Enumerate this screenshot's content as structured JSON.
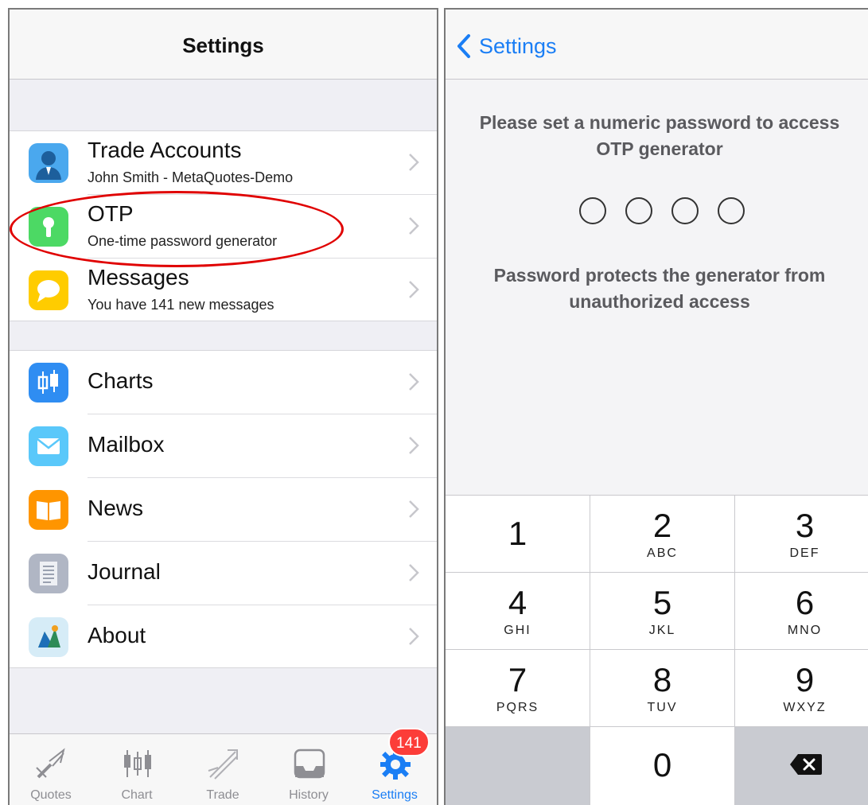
{
  "left": {
    "title": "Settings",
    "group1": [
      {
        "title": "Trade Accounts",
        "subtitle": "John  Smith - MetaQuotes-Demo",
        "icon": "person-icon",
        "color": "#4aa8ee"
      },
      {
        "title": "OTP",
        "subtitle": "One-time password generator",
        "icon": "keyhole-icon",
        "color": "#4cd964"
      },
      {
        "title": "Messages",
        "subtitle": "You have 141 new messages",
        "icon": "speech-bubble-icon",
        "color": "#ffcc00"
      }
    ],
    "group2": [
      {
        "title": "Charts",
        "icon": "candlestick-icon",
        "color": "#2f8df2"
      },
      {
        "title": "Mailbox",
        "icon": "envelope-icon",
        "color": "#5ac8fa"
      },
      {
        "title": "News",
        "icon": "book-icon",
        "color": "#ff9500"
      },
      {
        "title": "Journal",
        "icon": "document-icon",
        "color": "#b0b6c4"
      },
      {
        "title": "About",
        "icon": "metatrader-logo-icon",
        "color": "#d6ecf7"
      }
    ],
    "tabs": [
      {
        "label": "Quotes"
      },
      {
        "label": "Chart"
      },
      {
        "label": "Trade"
      },
      {
        "label": "History"
      },
      {
        "label": "Settings"
      }
    ],
    "badge": "141",
    "accent": "#1a7ef5"
  },
  "right": {
    "back_label": "Settings",
    "prompt_line1": "Please set a numeric password to access",
    "prompt_line2": "OTP generator",
    "info_line1": "Password protects the generator from",
    "info_line2": "unauthorized access",
    "keys": [
      {
        "digit": "1",
        "letters": ""
      },
      {
        "digit": "2",
        "letters": "ABC"
      },
      {
        "digit": "3",
        "letters": "DEF"
      },
      {
        "digit": "4",
        "letters": "GHI"
      },
      {
        "digit": "5",
        "letters": "JKL"
      },
      {
        "digit": "6",
        "letters": "MNO"
      },
      {
        "digit": "7",
        "letters": "PQRS"
      },
      {
        "digit": "8",
        "letters": "TUV"
      },
      {
        "digit": "9",
        "letters": "WXYZ"
      },
      {
        "digit": "0",
        "letters": ""
      }
    ]
  }
}
